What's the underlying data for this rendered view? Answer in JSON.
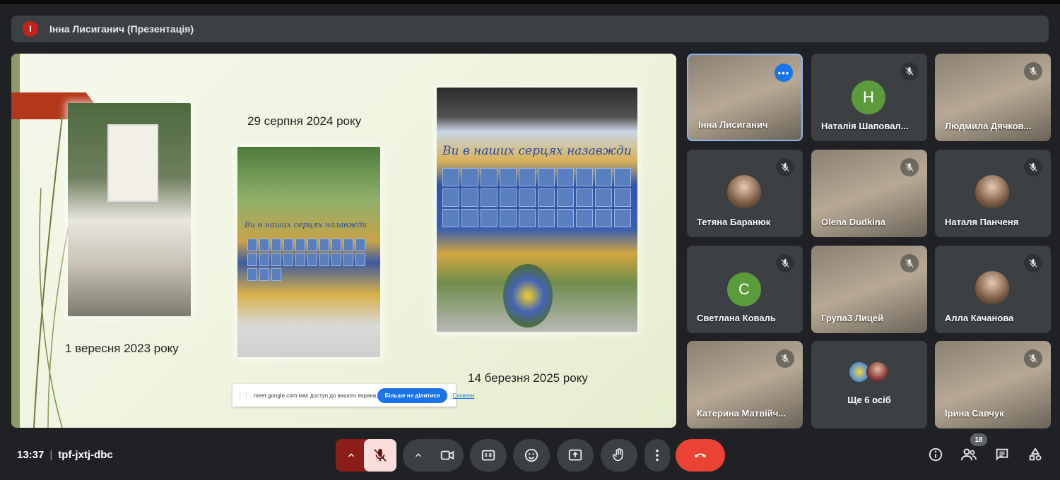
{
  "presenter": {
    "avatar_initial": "І",
    "label": "Інна Лисиганич (Презентація)"
  },
  "slide": {
    "captions": {
      "photo_1": "1 вересня 2023 року",
      "photo_2": "29 серпня 2024 року",
      "photo_3": "14 березня 2025 року"
    },
    "banner_text": "Ви в наших серцях назавжди"
  },
  "share_notice": {
    "text": "meet.google.com має доступ до вашого екрана.",
    "stop_button": "Більше не ділитися",
    "hide_link": "Сховати"
  },
  "participants": [
    {
      "name": "Інна Лисиганич",
      "type": "video",
      "active": true
    },
    {
      "name": "Наталія Шаповал...",
      "type": "initial",
      "initial": "Н",
      "color": "#5b9b3c"
    },
    {
      "name": "Людмила Дячков...",
      "type": "video"
    },
    {
      "name": "Тетяна Баранюк",
      "type": "photo"
    },
    {
      "name": "Olena Dudkina",
      "type": "video"
    },
    {
      "name": "Наталя Панченя",
      "type": "photo"
    },
    {
      "name": "Светлана Коваль",
      "type": "initial",
      "initial": "С",
      "color": "#5b9b3c"
    },
    {
      "name": "Група3 Лицей",
      "type": "video"
    },
    {
      "name": "Алла Качанова",
      "type": "photo"
    },
    {
      "name": "Катерина Матвійч...",
      "type": "video"
    },
    {
      "name": "Ще 6 осіб",
      "type": "more"
    },
    {
      "name": "Ірина Савчук",
      "type": "video"
    }
  ],
  "bottom_bar": {
    "time": "13:37",
    "meeting_code": "tpf-jxtj-dbc",
    "people_count": "18"
  },
  "colors": {
    "background": "#202124",
    "tile": "#3c4043",
    "end_call": "#ea4335",
    "mic_muted": "#f9dedc",
    "accent": "#1a73e8"
  },
  "icons": [
    "chevron-up-icon",
    "mic-off-icon",
    "camera-icon",
    "captions-icon",
    "emoji-icon",
    "present-icon",
    "raise-hand-icon",
    "more-options-icon",
    "end-call-icon",
    "info-icon",
    "people-icon",
    "chat-icon",
    "activities-icon"
  ]
}
